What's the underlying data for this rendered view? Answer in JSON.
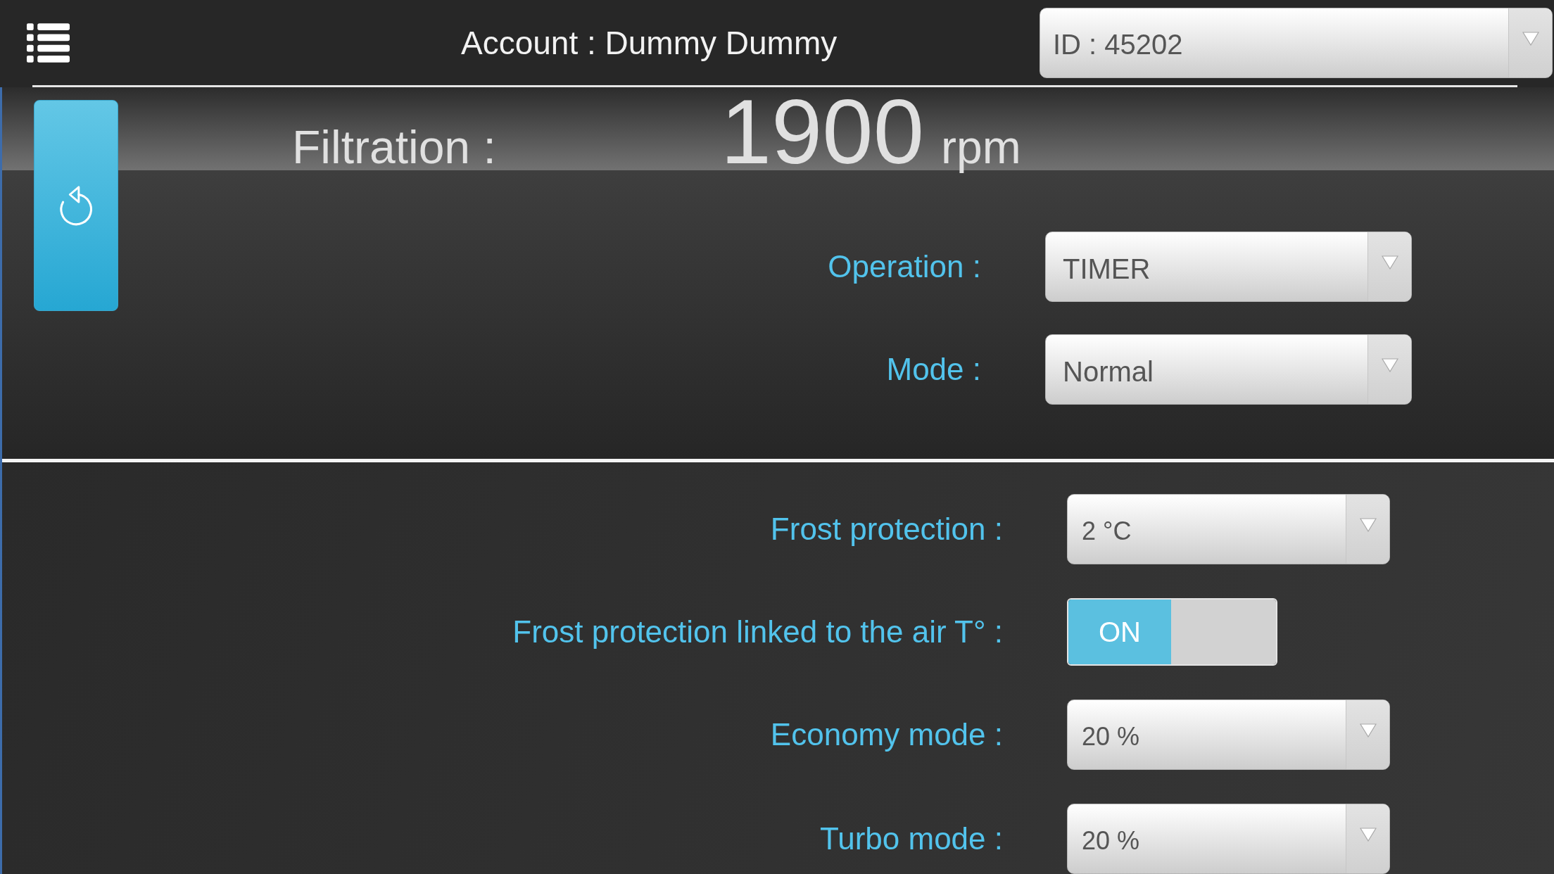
{
  "header": {
    "account": "Account : Dummy Dummy",
    "id_select": {
      "value": "ID : 45202"
    }
  },
  "filtration": {
    "label": "Filtration :",
    "value": "1900",
    "unit": "rpm"
  },
  "main_settings": [
    {
      "kind": "select",
      "label": "Operation :",
      "value": "TIMER"
    },
    {
      "kind": "select",
      "label": "Mode :",
      "value": "Normal"
    }
  ],
  "frost_settings": [
    {
      "kind": "select",
      "label": "Frost protection :",
      "value": "2 °C"
    },
    {
      "kind": "toggle",
      "label": "Frost protection linked to the air T° :",
      "on": true,
      "state_label": "ON"
    },
    {
      "kind": "select",
      "label": "Economy mode :",
      "value": "20 %"
    },
    {
      "kind": "select",
      "label": "Turbo mode :",
      "value": "20 %"
    }
  ]
}
